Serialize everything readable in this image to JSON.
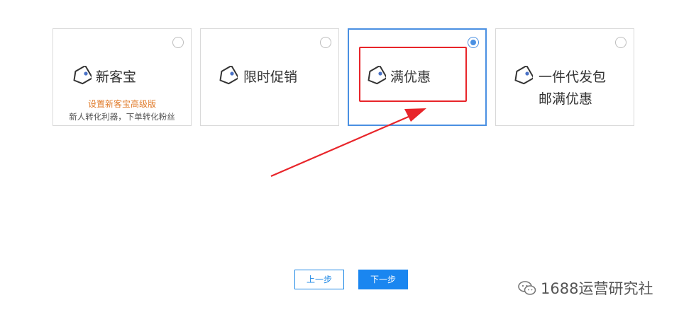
{
  "cards": [
    {
      "title": "新客宝",
      "subtitle": "设置新客宝高级版",
      "description": "新人转化利器，下单转化粉丝",
      "selected": false
    },
    {
      "title": "限时促销",
      "selected": false
    },
    {
      "title": "满优惠",
      "selected": true
    },
    {
      "title_line1": "一件代发包",
      "title_line2": "邮满优惠",
      "selected": false
    }
  ],
  "buttons": {
    "prev": "上一步",
    "next": "下一步"
  },
  "watermark": {
    "text": "1688运营研究社"
  },
  "colors": {
    "accent": "#4a90e2",
    "button_primary": "#1a86f0",
    "highlight": "#e8252a",
    "subtitle": "#e07b2a"
  },
  "icons": {
    "card": "price-tag-icon",
    "watermark": "wechat-icon"
  }
}
